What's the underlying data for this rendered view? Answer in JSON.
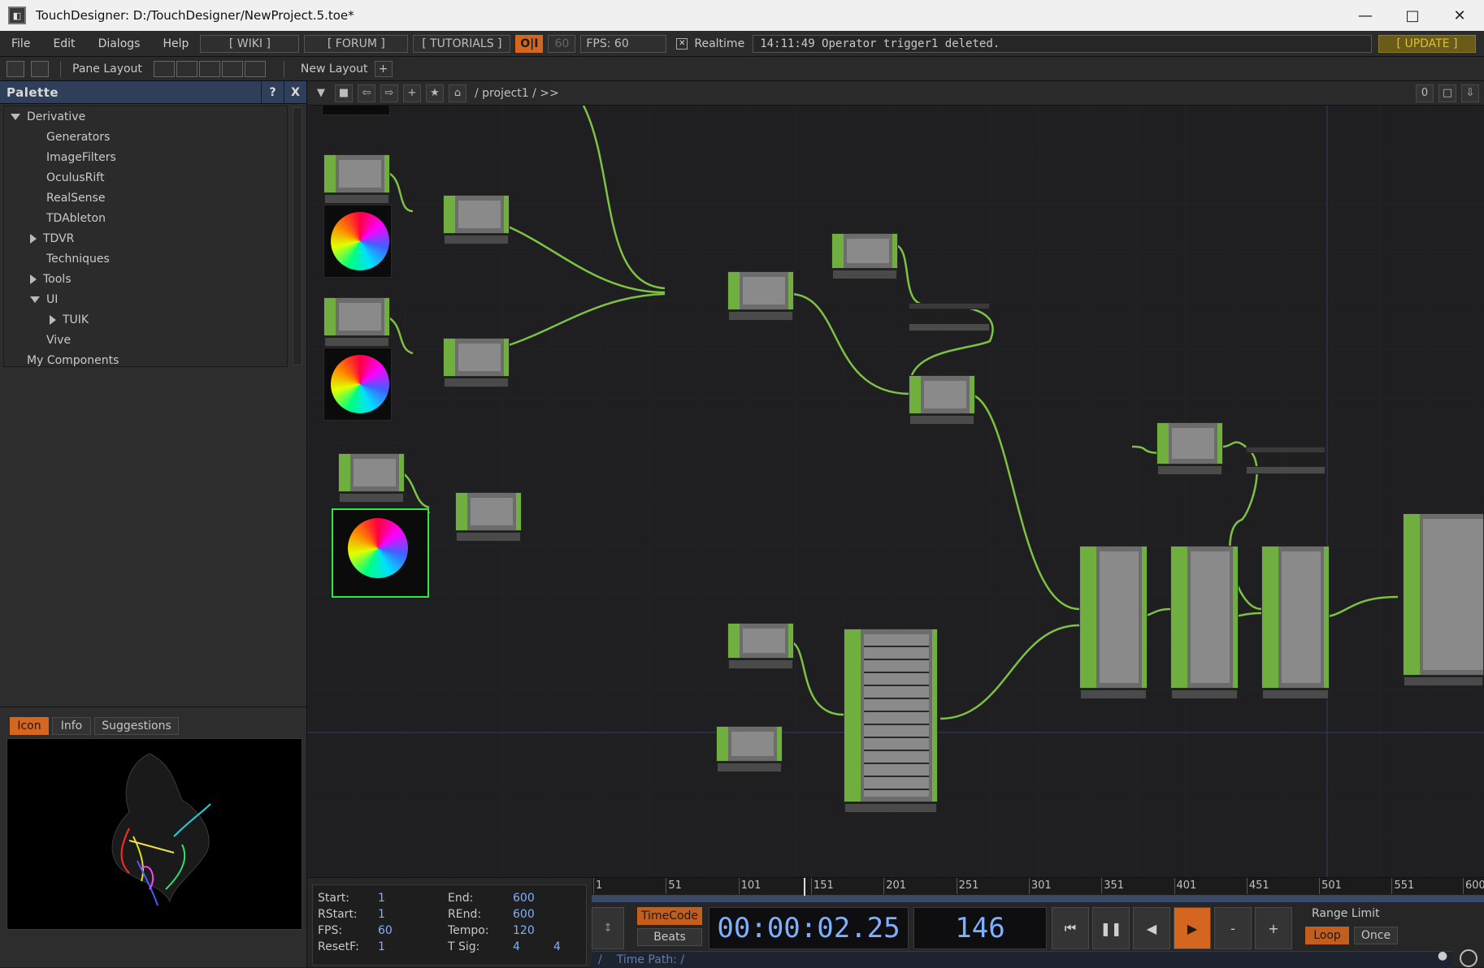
{
  "window": {
    "title": "TouchDesigner: D:/TouchDesigner/NewProject.5.toe*",
    "app_icon": "touchdesigner-logo-icon",
    "controls": [
      "minimize-icon",
      "maximize-icon",
      "close-icon"
    ]
  },
  "menubar": {
    "file": "File",
    "edit": "Edit",
    "dialogs": "Dialogs",
    "help": "Help",
    "wiki": "[ WIKI ]",
    "forum": "[ FORUM ]",
    "tutorials": "[ TUTORIALS ]",
    "oi": "O|I",
    "fps_target": "60",
    "fps": "FPS:  60",
    "realtime": "Realtime",
    "status": "14:11:49 Operator trigger1 deleted.",
    "update": "[ UPDATE ]"
  },
  "toolbar2": {
    "pane_layout": "Pane Layout",
    "new_layout": "New Layout",
    "add": "+"
  },
  "palette": {
    "title": "Palette",
    "help": "?",
    "close": "X",
    "items": [
      {
        "label": "Derivative",
        "indent": 0,
        "expander": "down"
      },
      {
        "label": "Generators",
        "indent": 1,
        "expander": "none"
      },
      {
        "label": "ImageFilters",
        "indent": 1,
        "expander": "none"
      },
      {
        "label": "OculusRift",
        "indent": 1,
        "expander": "none"
      },
      {
        "label": "RealSense",
        "indent": 1,
        "expander": "none"
      },
      {
        "label": "TDAbleton",
        "indent": 1,
        "expander": "none"
      },
      {
        "label": "TDVR",
        "indent": 1,
        "expander": "right"
      },
      {
        "label": "Techniques",
        "indent": 1,
        "expander": "none"
      },
      {
        "label": "Tools",
        "indent": 1,
        "expander": "right"
      },
      {
        "label": "UI",
        "indent": 1,
        "expander": "down"
      },
      {
        "label": "TUIK",
        "indent": 2,
        "expander": "right"
      },
      {
        "label": "Vive",
        "indent": 1,
        "expander": "none"
      },
      {
        "label": "My Components",
        "indent": 0,
        "expander": "none"
      }
    ]
  },
  "preview": {
    "tabs": [
      "Icon",
      "Info",
      "Suggestions"
    ],
    "active_tab": "Icon"
  },
  "pathbar": {
    "path": "/ project1 / >>",
    "right_value": "0"
  },
  "timeline": {
    "stats": {
      "start_label": "Start:",
      "start": "1",
      "end_label": "End:",
      "end": "600",
      "rstart_label": "RStart:",
      "rstart": "1",
      "rend_label": "REnd:",
      "rend": "600",
      "fps_label": "FPS:",
      "fps": "60",
      "tempo_label": "Tempo:",
      "tempo": "120",
      "resetf_label": "ResetF:",
      "resetf": "1",
      "tsig_label": "T Sig:",
      "tsig_a": "4",
      "tsig_b": "4"
    },
    "ruler": [
      "1",
      "51",
      "101",
      "151",
      "201",
      "251",
      "301",
      "351",
      "401",
      "451",
      "501",
      "551",
      "600"
    ],
    "playhead_frame": 146,
    "timecode_btn": "TimeCode",
    "beats_btn": "Beats",
    "timecode": "00:00:02.25",
    "frame": "146",
    "range_limit": "Range Limit",
    "loop": "Loop",
    "once": "Once",
    "minus": "-",
    "plus": "+",
    "time_path": "Time Path: /",
    "slash": "/"
  },
  "colors": {
    "accent_orange": "#d4661f",
    "node_green": "#6fae3f",
    "wire_green": "#7cc243",
    "selection": "#2ee84a",
    "palette_header": "#2f3f5a"
  }
}
